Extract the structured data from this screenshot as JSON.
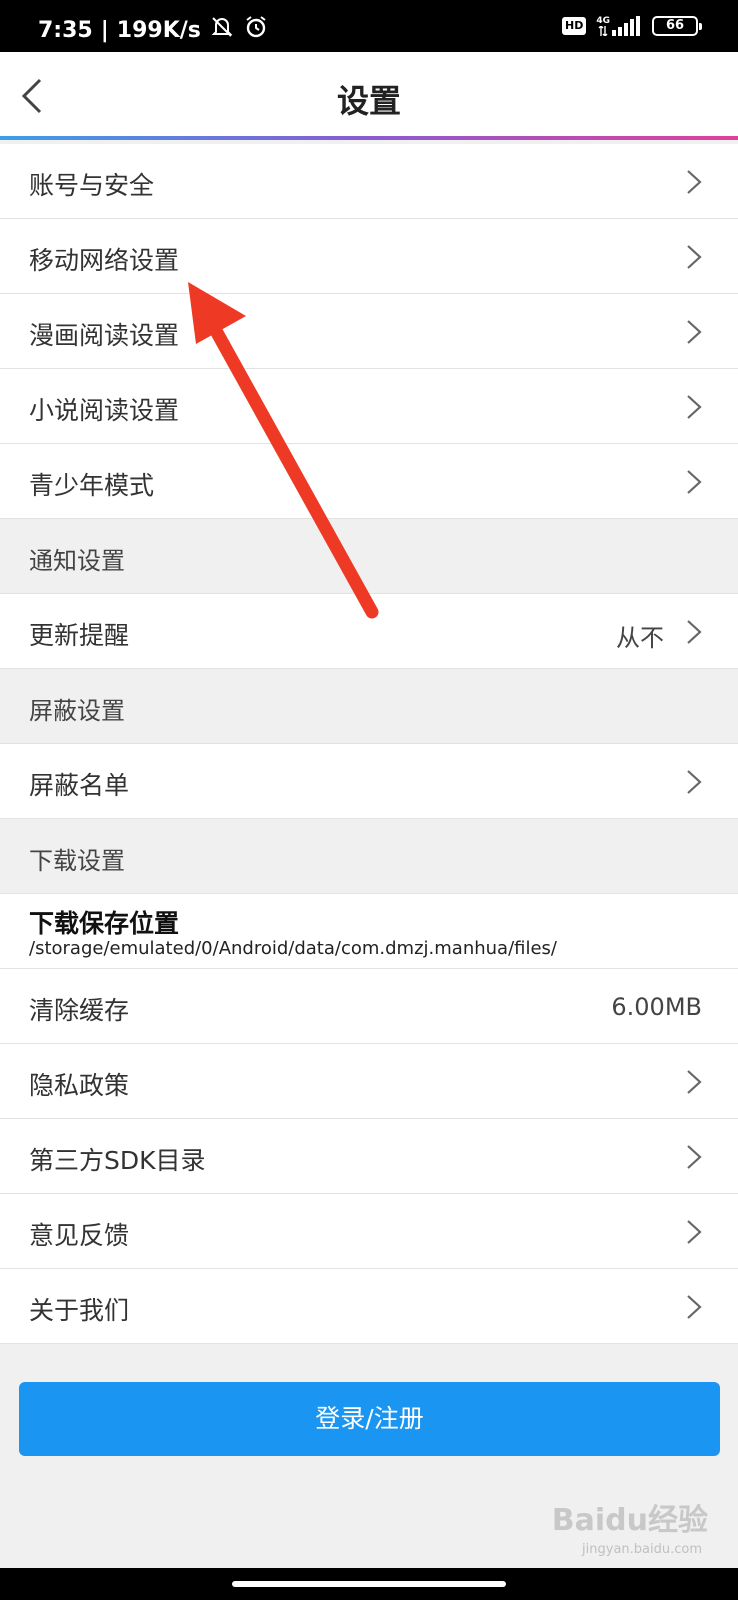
{
  "status_bar": {
    "time": "7:35",
    "net_speed": "199K/s",
    "hd": "HD",
    "network": "4G",
    "battery": "66"
  },
  "header": {
    "title": "设置"
  },
  "items": [
    {
      "label": "账号与安全",
      "type": "item",
      "arrow": true
    },
    {
      "label": "移动网络设置",
      "type": "item",
      "arrow": true
    },
    {
      "label": "漫画阅读设置",
      "type": "item",
      "arrow": true
    },
    {
      "label": "小说阅读设置",
      "type": "item",
      "arrow": true
    },
    {
      "label": "青少年模式",
      "type": "item",
      "arrow": true
    },
    {
      "label": "通知设置",
      "type": "section"
    },
    {
      "label": "更新提醒",
      "type": "item",
      "value": "从不",
      "arrow": true
    },
    {
      "label": "屏蔽设置",
      "type": "section"
    },
    {
      "label": "屏蔽名单",
      "type": "item",
      "arrow": true
    },
    {
      "label": "下载设置",
      "type": "section"
    },
    {
      "label": "下载保存位置",
      "type": "tall",
      "sub": "/storage/emulated/0/Android/data/com.dmzj.manhua/files/"
    },
    {
      "label": "清除缓存",
      "type": "item",
      "value": "6.00MB",
      "arrow": false
    },
    {
      "label": "隐私政策",
      "type": "item",
      "arrow": true
    },
    {
      "label": "第三方SDK目录",
      "type": "item",
      "arrow": true
    },
    {
      "label": "意见反馈",
      "type": "item",
      "arrow": true
    },
    {
      "label": "关于我们",
      "type": "item",
      "arrow": true
    }
  ],
  "login_button": "登录/注册",
  "watermark": {
    "brand": "Baidu经验",
    "site": "jingyan.baidu.com"
  },
  "colors": {
    "accent": "#1a95f2",
    "annotation_arrow": "#ee3a24"
  }
}
